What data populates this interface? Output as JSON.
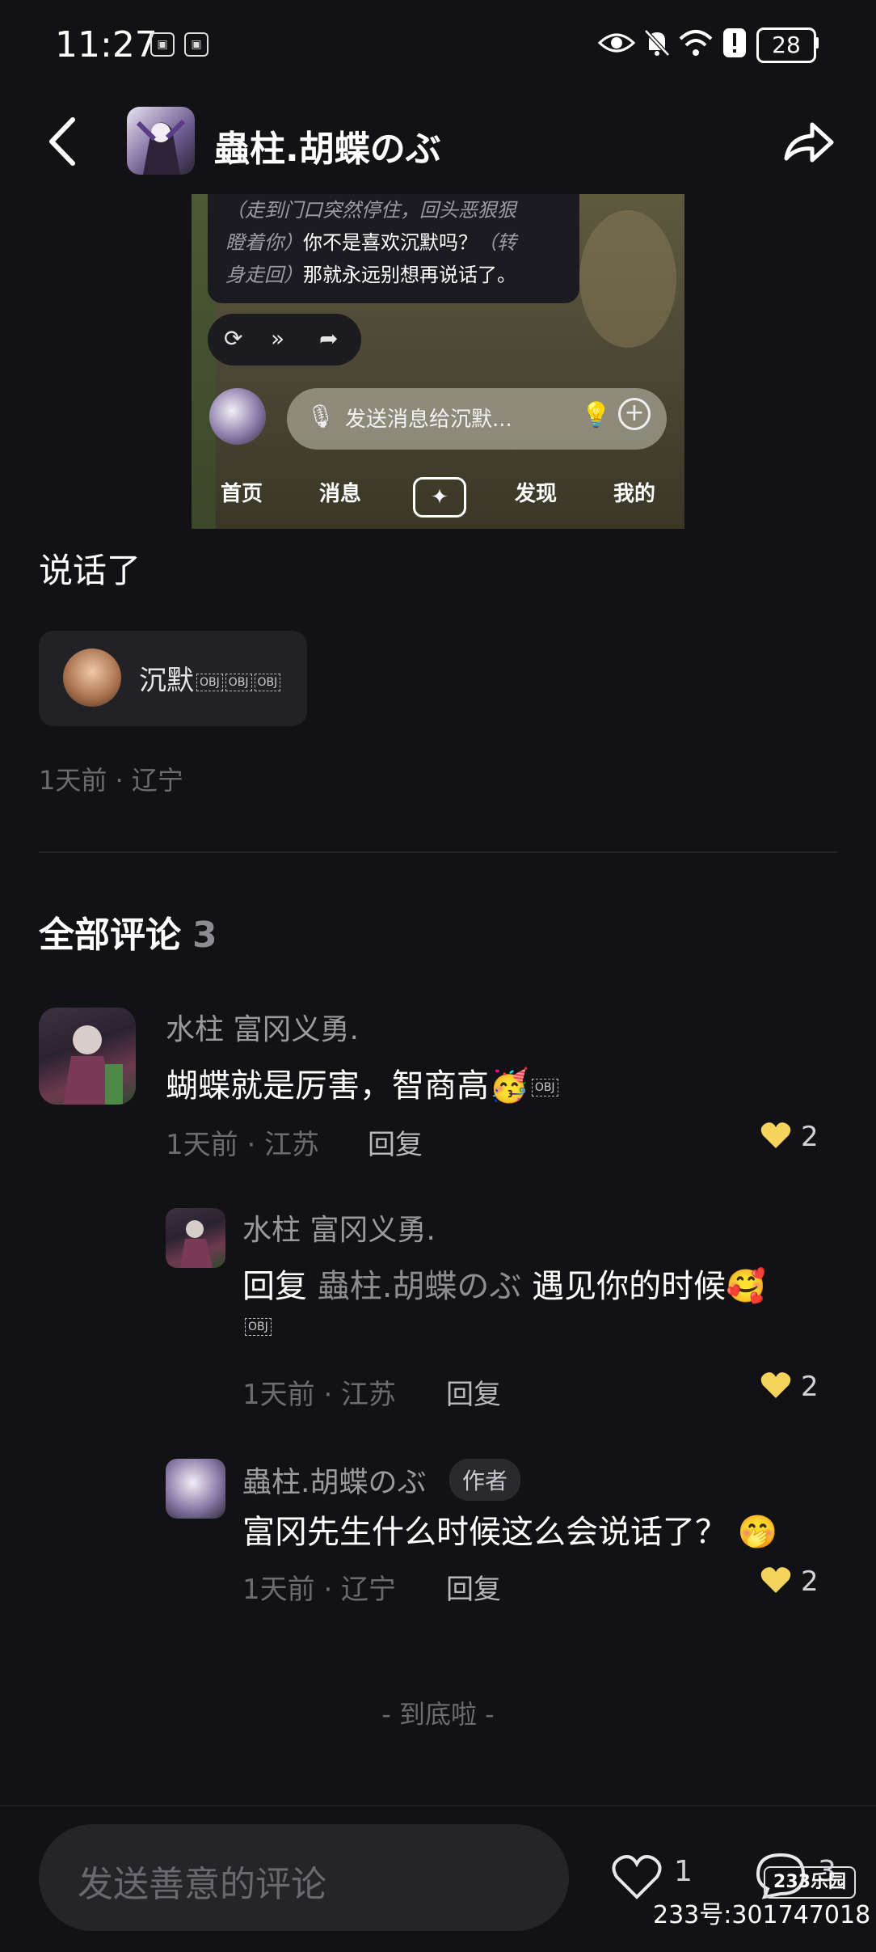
{
  "status_bar": {
    "time": "11:27",
    "battery": "28"
  },
  "header": {
    "title": "蟲柱.胡蝶のぶ"
  },
  "embedded_shot": {
    "bubble_line1_italic": "（走到门口突然停住，回头恶狠狠",
    "bubble_line2_italic": "瞪着你）",
    "bubble_line2_text": "你不是喜欢沉默吗？",
    "bubble_line2_italic2": "（转",
    "bubble_line3_italic": "身走回）",
    "bubble_line3_text": "那就永远别想再说话了。",
    "message_placeholder": "发送消息给沉默...",
    "nav": [
      "首页",
      "消息",
      "发现",
      "我的"
    ]
  },
  "post": {
    "text": "说话了",
    "mention_name": "沉默",
    "meta": "1天前 · 辽宁"
  },
  "comments_header": {
    "label": "全部评论",
    "count": "3"
  },
  "comments": [
    {
      "name": "水柱 富冈义勇.",
      "text": "蝴蝶就是厉害，智商高",
      "meta": "1天前 · 江苏",
      "reply": "回复",
      "likes": "2"
    },
    {
      "name": "水柱 富冈义勇.",
      "reply_prefix": "回复",
      "reply_to": "蟲柱.胡蝶のぶ",
      "text": "遇见你的时候",
      "meta": "1天前 · 江苏",
      "reply": "回复",
      "likes": "2"
    },
    {
      "name": "蟲柱.胡蝶のぶ",
      "tag": "作者",
      "text": "富冈先生什么时候这么会说话了？",
      "meta": "1天前 · 辽宁",
      "reply": "回复",
      "likes": "2"
    }
  ],
  "end_text": "- 到底啦 -",
  "bottom_bar": {
    "placeholder": "发送善意的评论",
    "likes": "1",
    "comments": "3"
  },
  "watermark": {
    "logo": "233乐园",
    "id": "233号:301747018"
  }
}
